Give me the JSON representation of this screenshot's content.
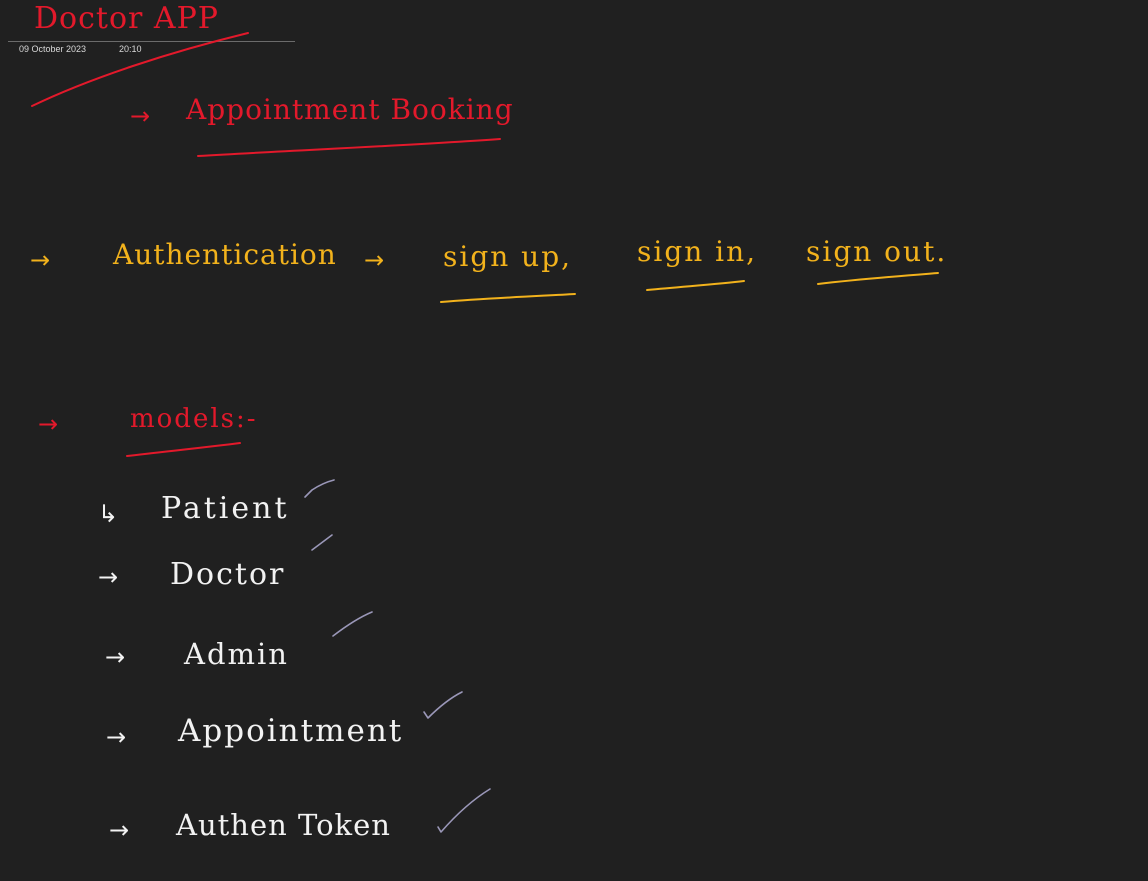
{
  "page": {
    "title": "Doctor APP",
    "date": "09 October 2023",
    "time": "20:10"
  },
  "notes": {
    "heading": {
      "arrow": "→",
      "text": "Appointment Booking"
    },
    "authentication": {
      "arrow": "→",
      "label": "Authentication",
      "arrow2": "→",
      "items": [
        "sign up,",
        "sign in,",
        "sign out."
      ]
    },
    "models": {
      "arrow": "→",
      "label": "models:-",
      "list": [
        {
          "bullet": "↳",
          "name": "Patient",
          "checked": true
        },
        {
          "bullet": "→",
          "name": "Doctor",
          "checked": true
        },
        {
          "bullet": "→",
          "name": "Admin",
          "checked": true
        },
        {
          "bullet": "→",
          "name": "Appointment",
          "checked": true
        },
        {
          "bullet": "→",
          "name": "Authen Token",
          "checked": true
        }
      ]
    }
  },
  "colors": {
    "background": "#202020",
    "red_ink": "#e3192b",
    "yellow_ink": "#f2b21c",
    "white_ink": "#f2f2f2",
    "check_ink": "#9a97b8"
  }
}
